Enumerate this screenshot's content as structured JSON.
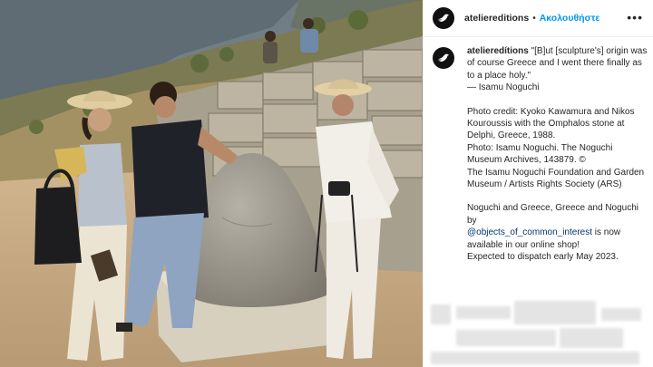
{
  "post": {
    "username": "ateliereditions",
    "separator": "•",
    "follow_label": "Ακολουθήστε",
    "more_icon": "more-horizontal-icon",
    "avatar_icon": "bird-logo-icon"
  },
  "caption": {
    "username": "atelieredítions",
    "quote": " \"[B]ut [sculpture's] origin was of course Greece and I went there finally as to a place holy.\"",
    "attribution": "— Isamu Noguchi",
    "credit_1": "Photo credit: Kyoko Kawamura and Nikos Kouroussis with the Omphalos stone at Delphi, Greece, 1988.",
    "credit_2": "Photo: Isamu Noguchi. The Noguchi Museum Archives, 143879. ©",
    "credit_3": "The Isamu Noguchi Foundation and Garden Museum / Artists Rights Society (ARS)",
    "shop_1": "Noguchi and Greece, Greece and Noguchi by",
    "shop_mention": "@objects_of_common_interest",
    "shop_2": " is now available in our online shop!",
    "shop_3": "Expected to dispatch early May 2023."
  },
  "colors": {
    "link_blue": "#0095f6",
    "mention_blue": "#00376b",
    "text": "#262626"
  }
}
